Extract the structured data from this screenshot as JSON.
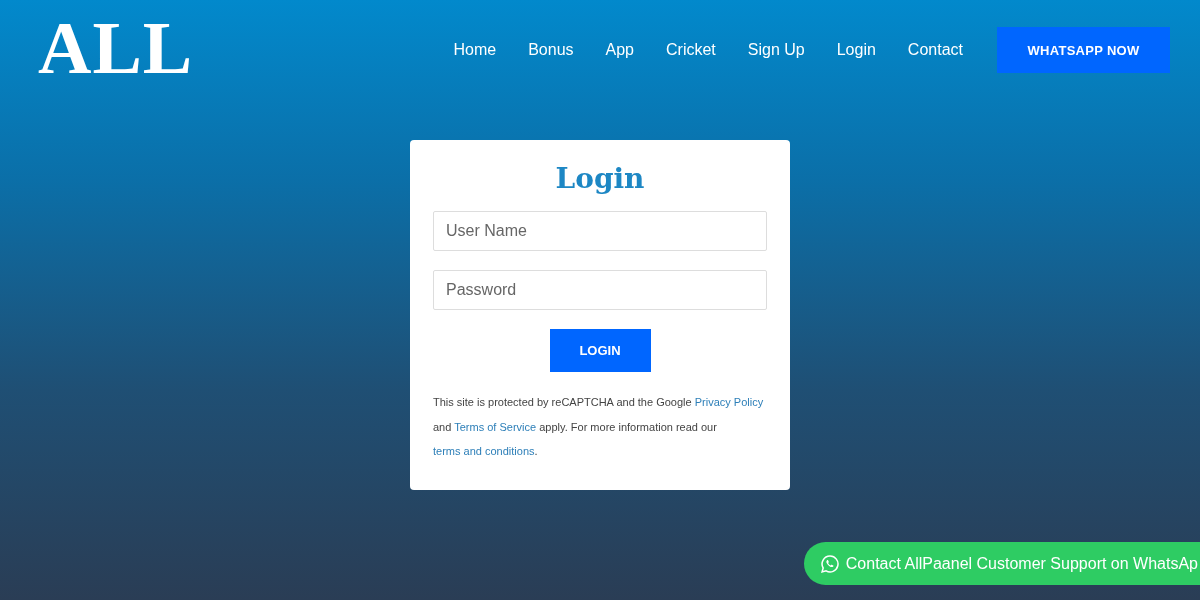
{
  "logo": "ALL",
  "nav": [
    {
      "label": "Home"
    },
    {
      "label": "Bonus"
    },
    {
      "label": "App"
    },
    {
      "label": "Cricket"
    },
    {
      "label": "Sign Up"
    },
    {
      "label": "Login"
    },
    {
      "label": "Contact"
    }
  ],
  "cta": "WHATSAPP NOW",
  "login": {
    "title": "Login",
    "fields": [
      {
        "placeholder": "User Name"
      },
      {
        "placeholder": "Password"
      }
    ],
    "button": "LOGIN",
    "notice": [
      {
        "kind": "text",
        "text": "This site is protected by reCAPTCHA and the Google "
      },
      {
        "kind": "link",
        "text": "Privacy Policy"
      },
      {
        "kind": "text",
        "text": " and "
      },
      {
        "kind": "link",
        "text": "Terms of Service"
      },
      {
        "kind": "text",
        "text": " apply. For more information read our "
      },
      {
        "kind": "link",
        "text": "terms and conditions"
      },
      {
        "kind": "text",
        "text": "."
      }
    ]
  },
  "support": "Contact AllPaanel Customer Support on WhatsAp"
}
